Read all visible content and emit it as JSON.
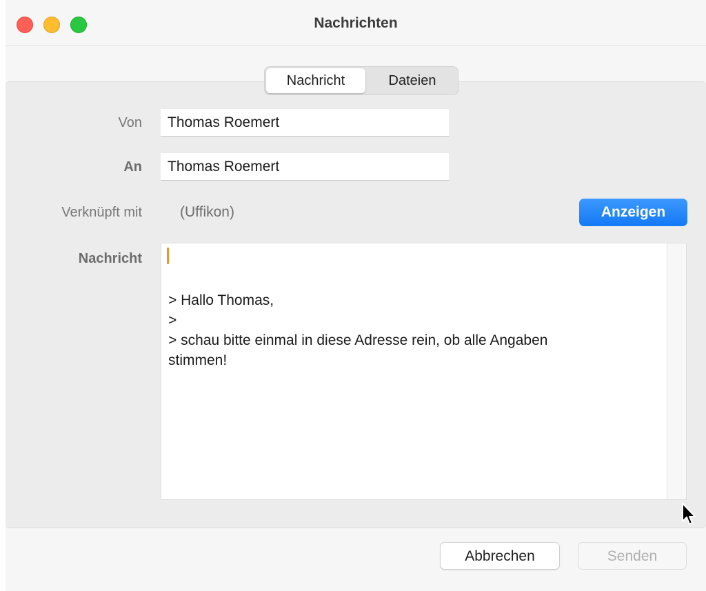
{
  "window": {
    "title": "Nachrichten"
  },
  "tabs": [
    {
      "label": "Nachricht",
      "active": true
    },
    {
      "label": "Dateien",
      "active": false
    }
  ],
  "form": {
    "from_label": "Von",
    "from_value": "Thomas Roemert",
    "to_label": "An",
    "to_value": "Thomas Roemert",
    "linked_label": "Verknüpft mit",
    "linked_value": "(Uffikon)",
    "show_button": "Anzeigen",
    "message_label": "Nachricht",
    "message_lines": [
      "",
      "",
      "> Hallo Thomas,",
      ">",
      "> schau bitte einmal in diese Adresse rein, ob alle Angaben",
      "stimmen!"
    ]
  },
  "footer": {
    "cancel_label": "Abbrechen",
    "send_label": "Senden"
  },
  "colors": {
    "accent": "#1a7ef7",
    "caret": "#f0922a",
    "close": "#ff5f57",
    "minimize": "#febc2e",
    "zoom": "#28c840"
  },
  "icons": [
    "close-icon",
    "minimize-icon",
    "zoom-icon",
    "mouse-pointer-icon"
  ]
}
